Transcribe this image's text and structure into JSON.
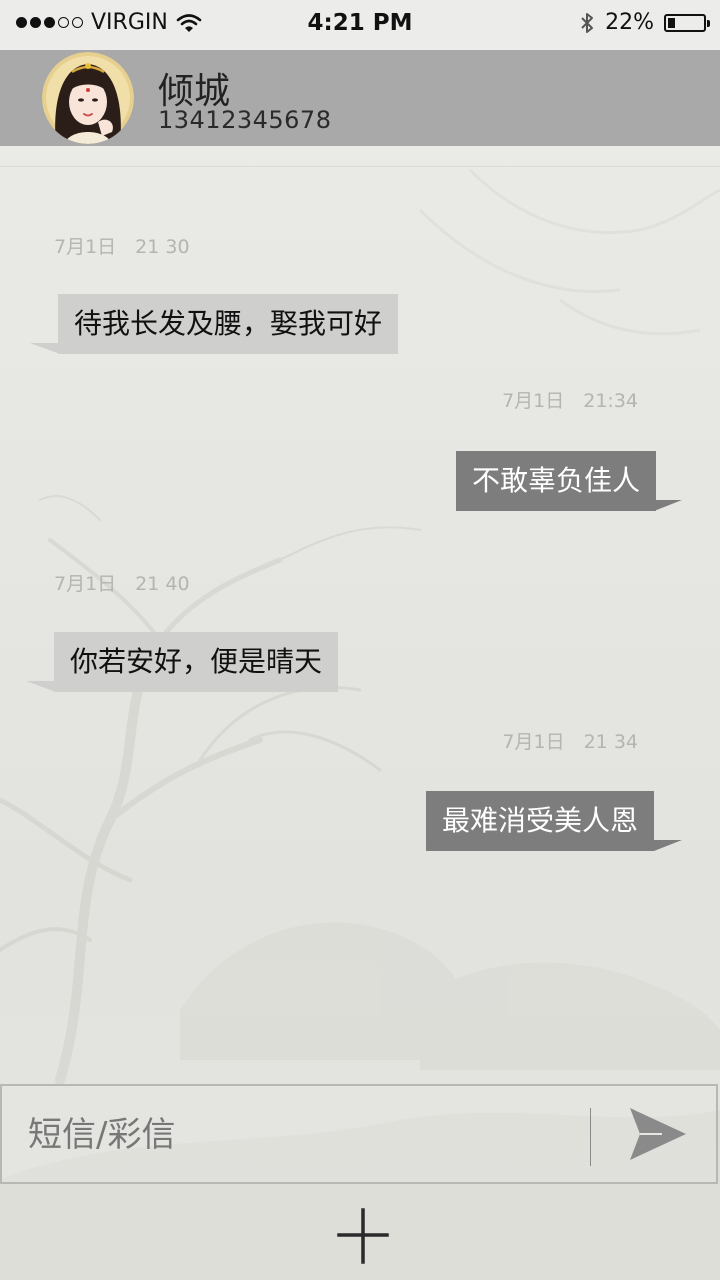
{
  "status_bar": {
    "carrier": "VIRGIN",
    "time": "4:21 PM",
    "battery_percent": "22%",
    "battery_level": 0.22,
    "signal_bars": 3,
    "signal_total": 5,
    "icons": [
      "signal-dots-icon",
      "wifi-icon",
      "bluetooth-icon",
      "battery-icon"
    ]
  },
  "contact": {
    "name": "倾城",
    "number": "13412345678",
    "avatar_icon": "avatar-portrait"
  },
  "messages": [
    {
      "direction": "incoming",
      "timestamp": "7月1日　21  30",
      "text": "待我长发及腰，娶我可好"
    },
    {
      "direction": "outgoing",
      "timestamp": "7月1日　21:34",
      "text": "不敢辜负佳人"
    },
    {
      "direction": "incoming",
      "timestamp": "7月1日　21  40",
      "text": "你若安好，便是晴天"
    },
    {
      "direction": "outgoing",
      "timestamp": "7月1日　21  34",
      "text": "最难消受美人恩"
    }
  ],
  "composer": {
    "placeholder": "短信/彩信",
    "value": "",
    "send_icon": "send-icon",
    "add_icon": "plus-icon"
  },
  "colors": {
    "header_bg": "#a9a9a9",
    "incoming_bubble": "#cfcfcd",
    "outgoing_bubble": "#7d7d7d",
    "timestamp": "#b4b4b0"
  }
}
